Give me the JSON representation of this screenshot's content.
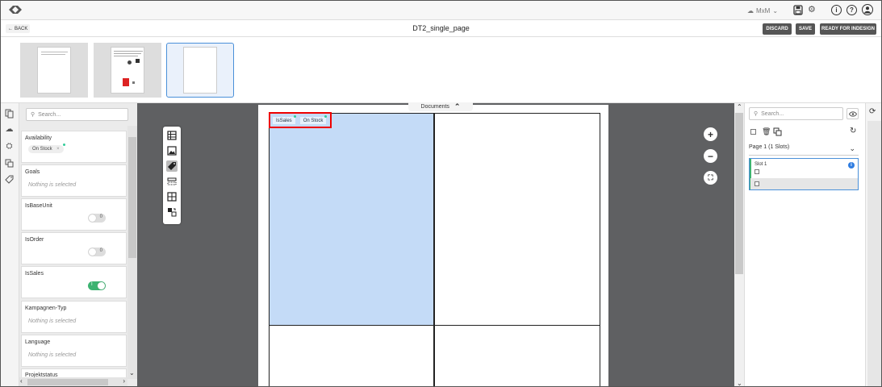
{
  "header": {
    "user_label": "MxM",
    "back_label": "BACK",
    "document_title": "DT2_single_page",
    "discard_label": "DISCARD",
    "save_label": "SAVE",
    "ready_label": "READY FOR INDESIGN"
  },
  "thumbnails": [
    {
      "name": "page-1",
      "selected": false
    },
    {
      "name": "page-2",
      "selected": false
    },
    {
      "name": "page-3",
      "selected": true
    }
  ],
  "left_icons": [
    "pages-icon",
    "brand-icon",
    "products-icon",
    "layers-icon",
    "tag-icon"
  ],
  "filter_panel": {
    "search_placeholder": "Search...",
    "filters": [
      {
        "label": "Availability",
        "kind": "chip",
        "chip": "On Stock",
        "chip_x": "×"
      },
      {
        "label": "Goals",
        "kind": "placeholder",
        "placeholder": "Nothing is selected"
      },
      {
        "label": "IsBaseUnit",
        "kind": "toggle",
        "toggle_text": "0",
        "on": false
      },
      {
        "label": "IsOrder",
        "kind": "toggle",
        "toggle_text": "0",
        "on": false
      },
      {
        "label": "IsSales",
        "kind": "toggle",
        "toggle_text": "I",
        "on": true
      },
      {
        "label": "Kampagnen-Typ",
        "kind": "placeholder",
        "placeholder": "Nothing is selected"
      },
      {
        "label": "Language",
        "kind": "placeholder",
        "placeholder": "Nothing is selected"
      },
      {
        "label": "Projektstatus",
        "kind": "partial"
      }
    ]
  },
  "canvas": {
    "documents_tab": "Documents",
    "slot_tags": [
      "IsSales",
      "On Stock"
    ],
    "zoom_in": "+",
    "zoom_out": "−",
    "fit": "⛶"
  },
  "right_panel": {
    "search_placeholder": "Search...",
    "page_header": "Page 1 (1 Slots)",
    "slot_title": "Slot 1",
    "info": "i"
  },
  "colors": {
    "accent": "#4a90d9",
    "toggle_on": "#3cb371",
    "slot_fill": "#c4dbf7",
    "highlight": "#e00000",
    "canvas_bg": "#5f6062"
  }
}
